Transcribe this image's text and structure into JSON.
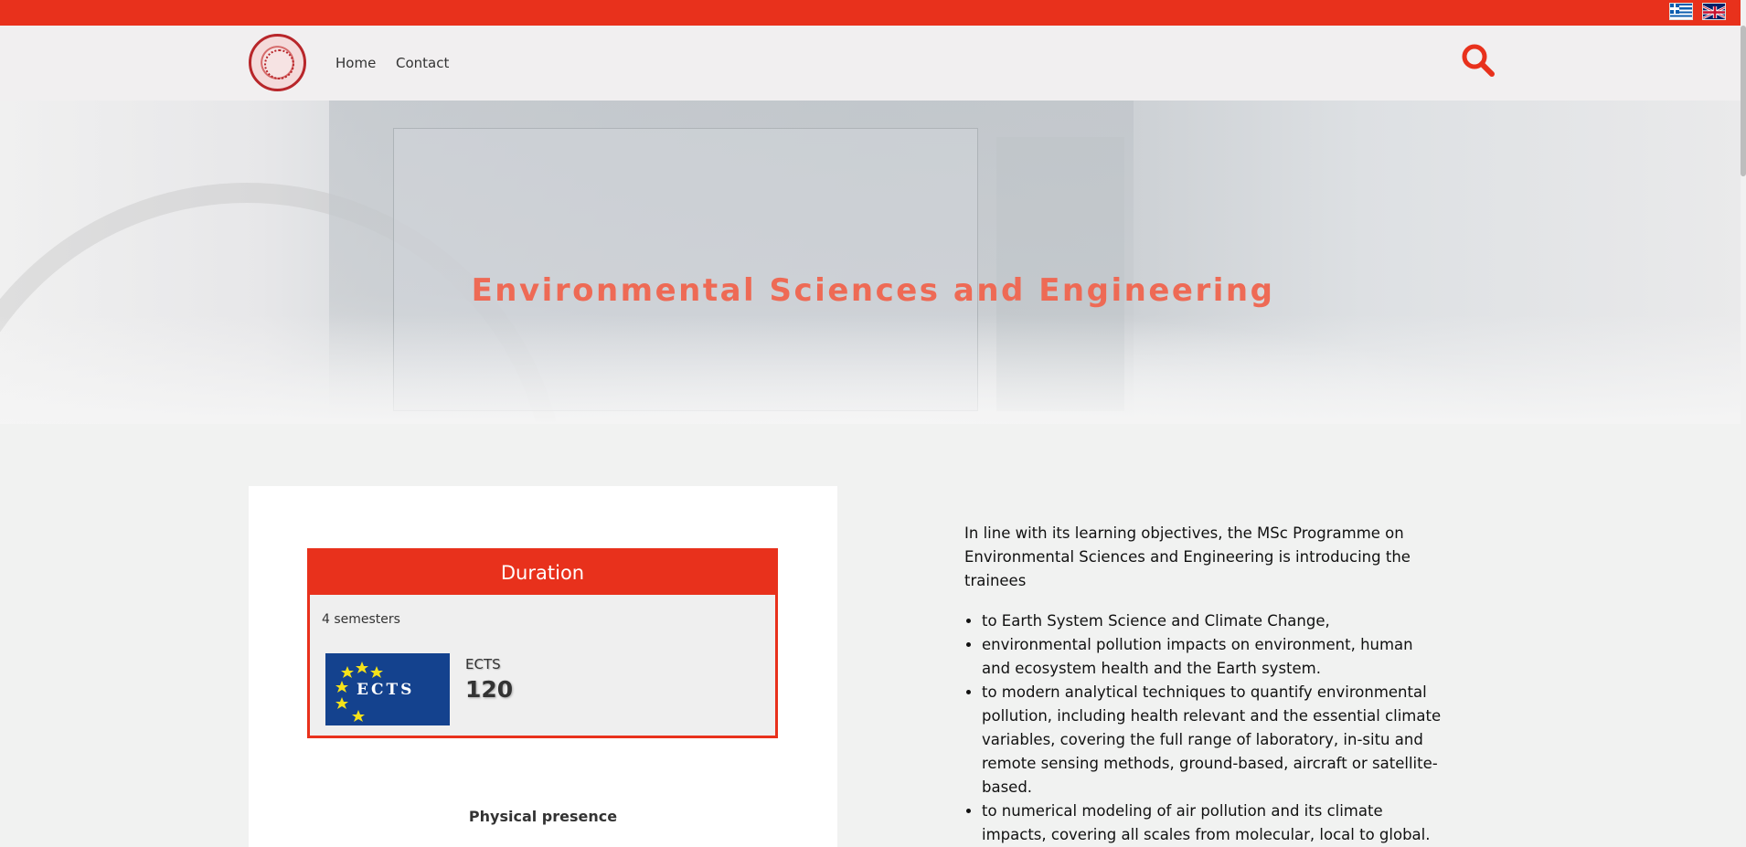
{
  "header": {
    "nav": [
      {
        "label": "Home"
      },
      {
        "label": "Contact"
      }
    ]
  },
  "hero": {
    "title": "Environmental Sciences and Engineering"
  },
  "duration": {
    "header": "Duration",
    "semesters": "4 semesters",
    "ects_label": "ECTS",
    "ects_value": "120",
    "ects_logo_text": "ECTS",
    "presence": "Physical presence"
  },
  "content": {
    "intro": "In line with its learning objectives, the MSc Programme on Environmental Sciences and Engineering is introducing the trainees",
    "bullets": [
      "to Earth System Science and Climate Change,",
      "environmental pollution impacts on environment, human and ecosystem health and the Earth system.",
      "to modern analytical techniques to quantify environmental pollution, including health relevant and the essential climate variables, covering the full range of laboratory, in-situ and remote sensing methods, ground-based, aircraft or satellite-based.",
      "to numerical modeling of air pollution and its climate impacts, covering all scales from molecular, local to global."
    ]
  },
  "colors": {
    "brand_red": "#e8311c",
    "hero_title": "#ee6a55"
  },
  "icons": {
    "search": "search-icon",
    "flag_greek": "greek-flag-icon",
    "flag_uk": "uk-flag-icon"
  }
}
